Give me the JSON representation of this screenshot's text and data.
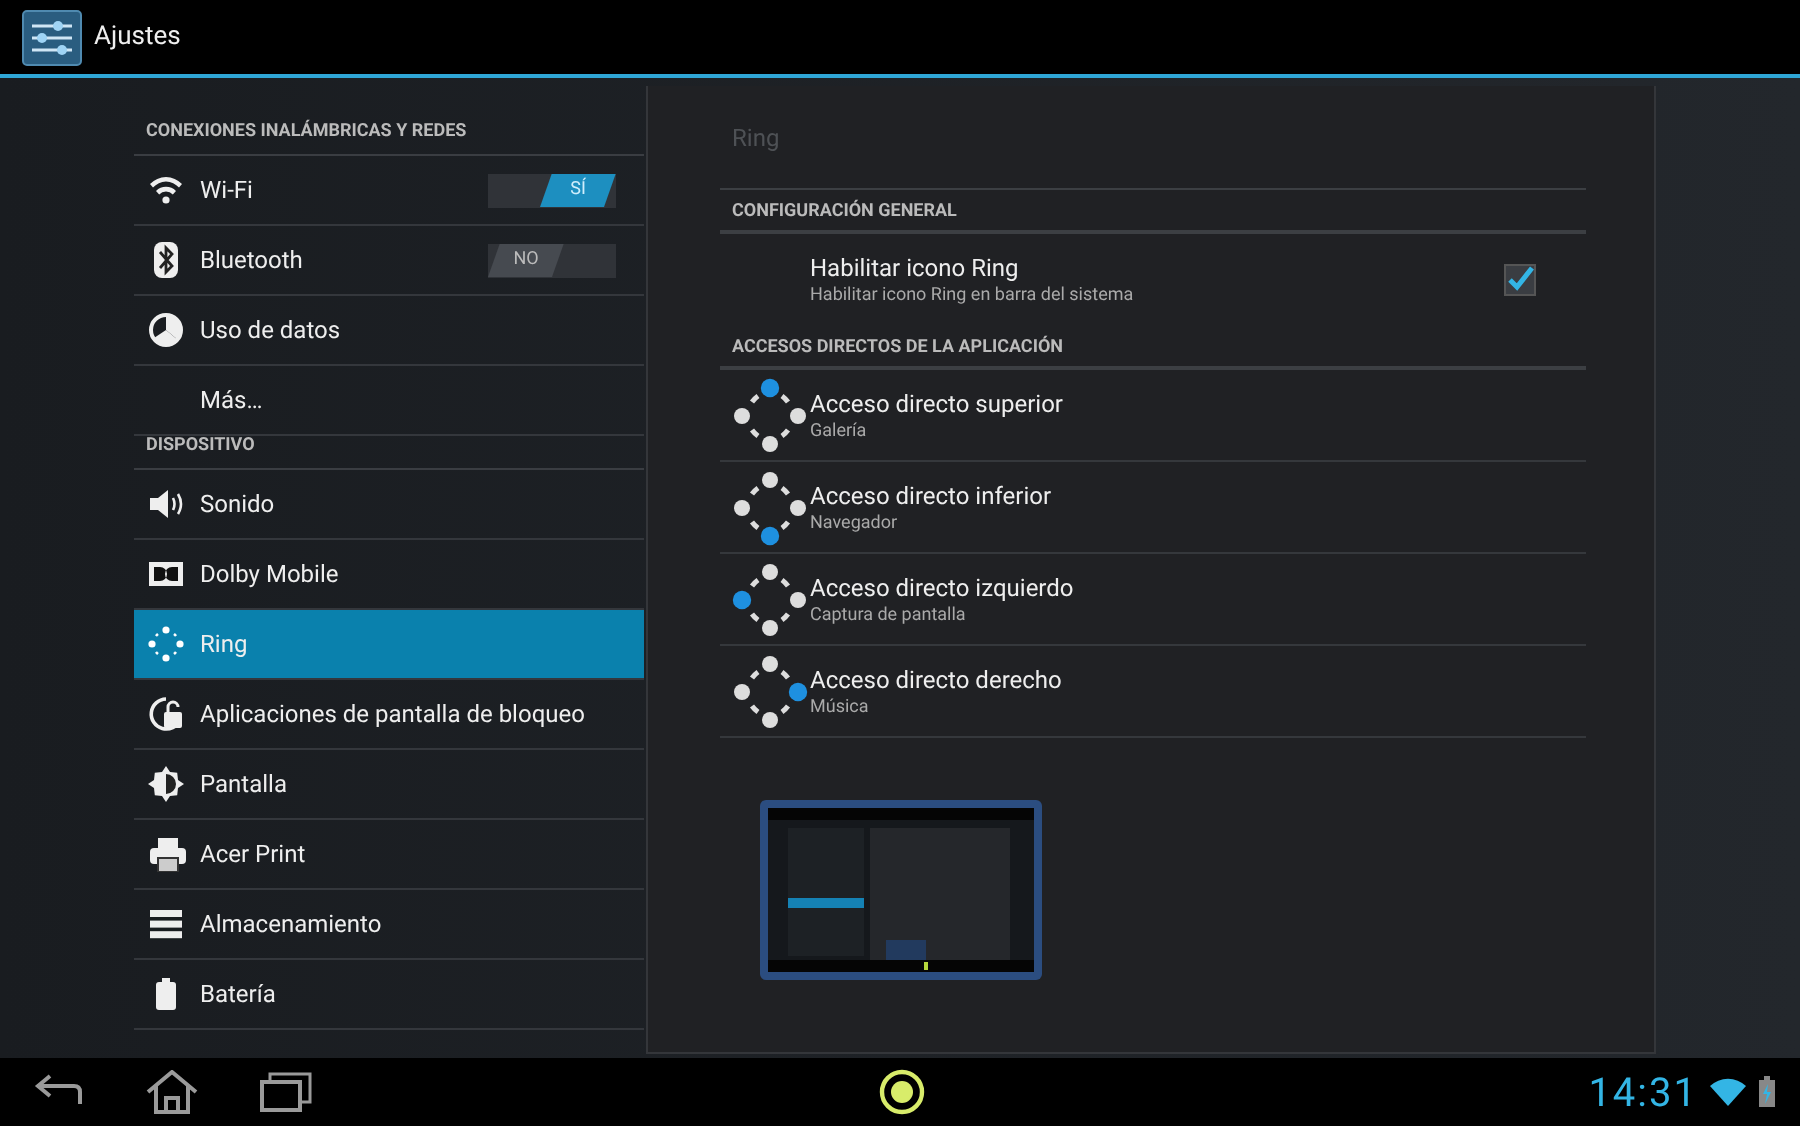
{
  "action_bar": {
    "title": "Ajustes"
  },
  "sidebar": {
    "items": [
      {
        "kind": "header",
        "label": "CONEXIONES INALÁMBRICAS Y REDES"
      },
      {
        "kind": "switch",
        "label": "Wi-Fi",
        "switch_label": "SÍ",
        "on": true,
        "selected": false
      },
      {
        "kind": "switch",
        "label": "Bluetooth",
        "switch_label": "NO",
        "on": false,
        "selected": false
      },
      {
        "kind": "item",
        "label": "Uso de datos",
        "selected": false
      },
      {
        "kind": "item",
        "label": "Más…",
        "selected": false
      },
      {
        "kind": "header",
        "label": "DISPOSITIVO"
      },
      {
        "kind": "item",
        "label": "Sonido",
        "selected": false
      },
      {
        "kind": "item",
        "label": "Dolby Mobile",
        "selected": false
      },
      {
        "kind": "item",
        "label": "Ring",
        "selected": true
      },
      {
        "kind": "item",
        "label": "Aplicaciones de pantalla de bloqueo",
        "selected": false
      },
      {
        "kind": "item",
        "label": "Pantalla",
        "selected": false
      },
      {
        "kind": "item",
        "label": "Acer Print",
        "selected": false
      },
      {
        "kind": "item",
        "label": "Almacenamiento",
        "selected": false
      },
      {
        "kind": "item",
        "label": "Batería",
        "selected": false
      }
    ]
  },
  "detail": {
    "title": "Ring",
    "items": [
      {
        "kind": "header",
        "label": "CONFIGURACIÓN GENERAL"
      },
      {
        "kind": "checkbox",
        "title": "Habilitar icono Ring",
        "summary": "Habilitar icono Ring en barra del sistema",
        "checked": true
      },
      {
        "kind": "header",
        "label": "ACCESOS DIRECTOS DE LA APLICACIÓN"
      },
      {
        "kind": "shortcut",
        "title": "Acceso directo superior",
        "summary": "Galería"
      },
      {
        "kind": "shortcut",
        "title": "Acceso directo inferior",
        "summary": "Navegador"
      },
      {
        "kind": "shortcut",
        "title": "Acceso directo izquierdo",
        "summary": "Captura de pantalla"
      },
      {
        "kind": "shortcut",
        "title": "Acceso directo derecho",
        "summary": "Música"
      }
    ]
  },
  "system_bar": {
    "time": "14:31"
  }
}
